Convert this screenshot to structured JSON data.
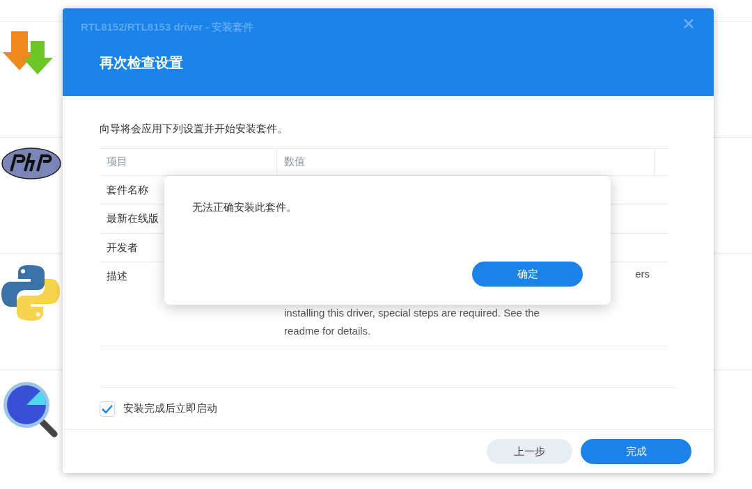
{
  "background_apps": [
    {
      "kind": "download"
    },
    {
      "kind": "php"
    },
    {
      "kind": "python"
    },
    {
      "kind": "search"
    }
  ],
  "dialog": {
    "window_title": "RTL8152/RTL8153 driver - 安装套件",
    "step_title": "再次检查设置",
    "intro": "向导将会应用下列设置并开始安装套件。",
    "table": {
      "columns": [
        "项目",
        "数值"
      ],
      "rows": [
        {
          "item": "套件名称",
          "value_lines": []
        },
        {
          "item": "最新在线版",
          "value_lines": []
        },
        {
          "item": "开发者",
          "value_lines": []
        },
        {
          "item": "描述",
          "value_lines": [
            "ers",
            "installing this driver, special steps are required. See the",
            "readme for details."
          ]
        }
      ]
    },
    "start_after_install": {
      "label": "安装完成后立即启动",
      "checked": true
    },
    "buttons": [
      {
        "label": "上一步",
        "kind": "secondary"
      },
      {
        "label": "完成",
        "kind": "primary"
      }
    ]
  },
  "alert": {
    "message": "无法正确安装此套件。",
    "button": "确定"
  }
}
